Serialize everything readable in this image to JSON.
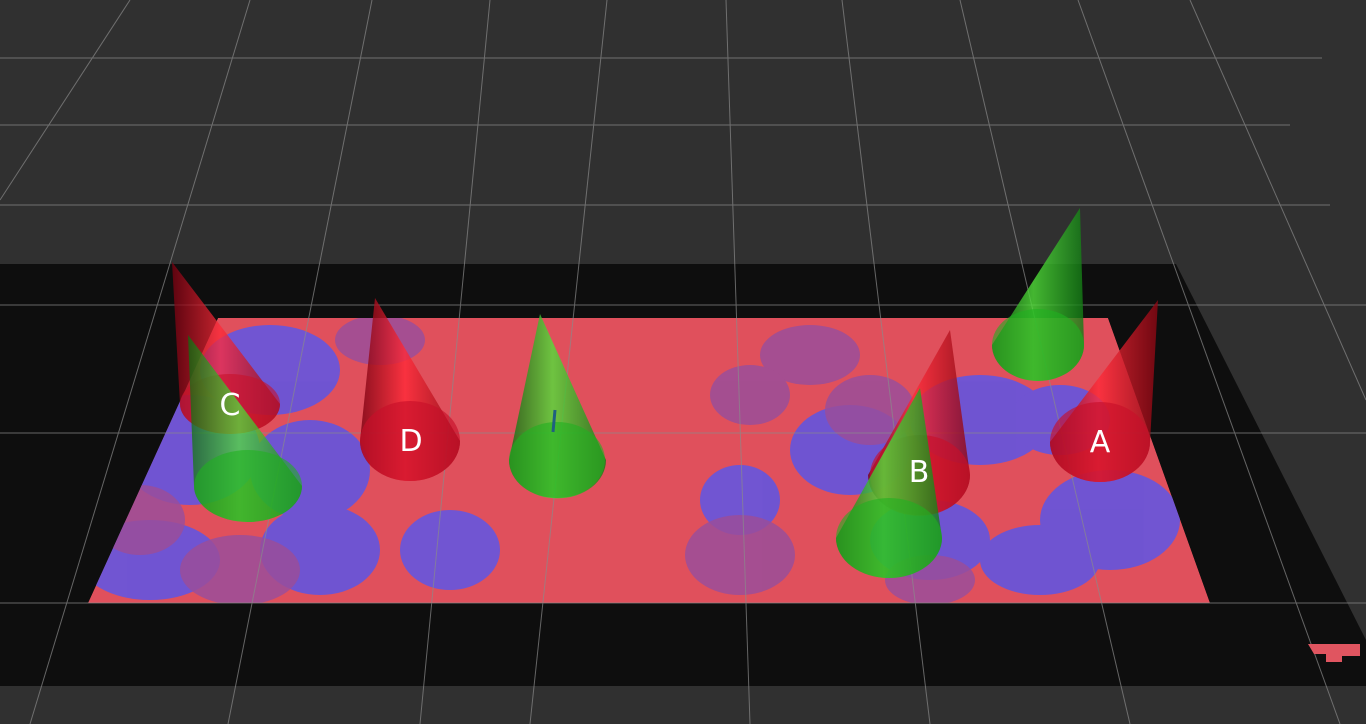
{
  "scene": {
    "background_color": "#303030",
    "grid_color": "#8a8a8a",
    "map_border_color": "#0d0d0d",
    "cost_high_color": "#e0505c",
    "cost_low_color": "#6a55d8",
    "red_cone_color": "#e0101e",
    "green_cone_color": "#28c81e"
  },
  "labels": {
    "a": "A",
    "b": "B",
    "c": "C",
    "d": "D"
  }
}
